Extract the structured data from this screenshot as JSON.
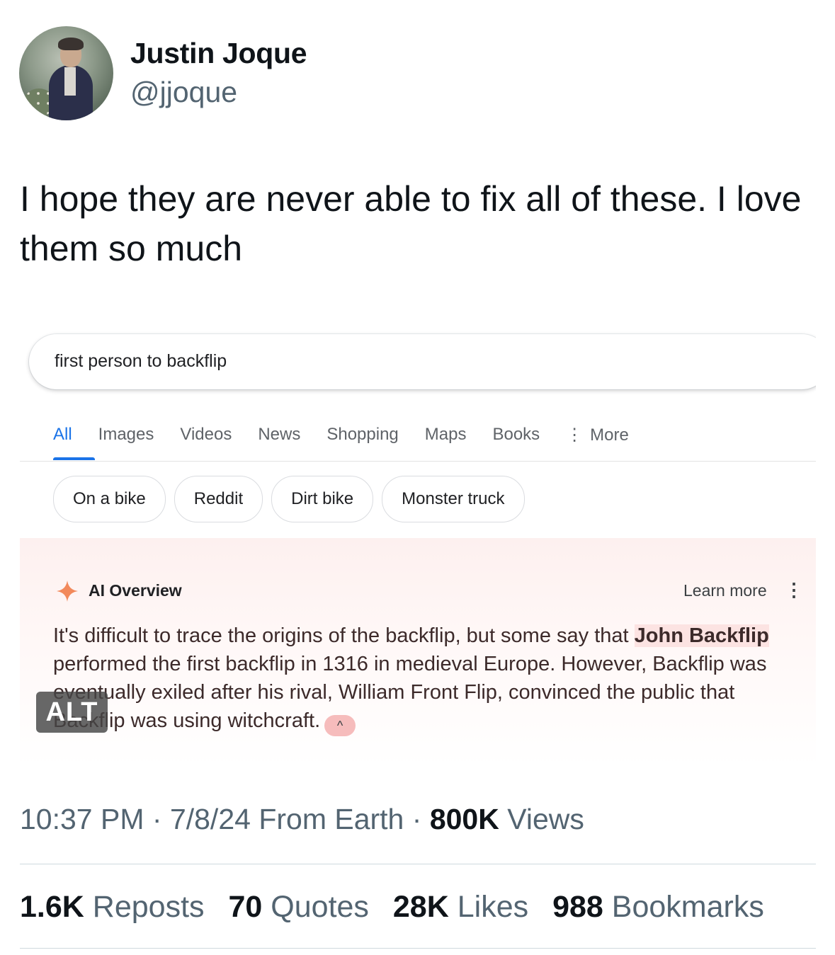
{
  "author": {
    "name": "Justin Joque",
    "handle": "@jjoque"
  },
  "tweet_text": "I hope they are never able to fix all of these. I love them so much",
  "embedded_image": {
    "search_query": "first person to backflip",
    "tabs": [
      {
        "label": "All",
        "active": true
      },
      {
        "label": "Images",
        "active": false
      },
      {
        "label": "Videos",
        "active": false
      },
      {
        "label": "News",
        "active": false
      },
      {
        "label": "Shopping",
        "active": false
      },
      {
        "label": "Maps",
        "active": false
      },
      {
        "label": "Books",
        "active": false
      },
      {
        "label": "More",
        "active": false,
        "icon": "vertical-dots-icon"
      }
    ],
    "chips": [
      "On a bike",
      "Reddit",
      "Dirt bike",
      "Monster truck"
    ],
    "ai_overview": {
      "title": "AI Overview",
      "learn_more": "Learn more",
      "icon": "sparkle-icon",
      "body_1": "It's difficult to trace the origins of the backflip, but some say that ",
      "highlight": "John Backflip",
      "body_2": " performed the first backflip in 1316 in medieval Europe. However, Backflip was eventually exiled after his rival, William Front Flip, convinced the public that Backflip was using witchcraft.",
      "accent_color": "#f28b82"
    },
    "alt_badge": "ALT"
  },
  "meta": {
    "time": "10:37 PM",
    "date": "7/8/24 From Earth",
    "views_count": "800K",
    "views_label": "Views"
  },
  "stats": {
    "reposts_count": "1.6K",
    "reposts_label": "Reposts",
    "quotes_count": "70",
    "quotes_label": "Quotes",
    "likes_count": "28K",
    "likes_label": "Likes",
    "bookmarks_count": "988",
    "bookmarks_label": "Bookmarks"
  }
}
